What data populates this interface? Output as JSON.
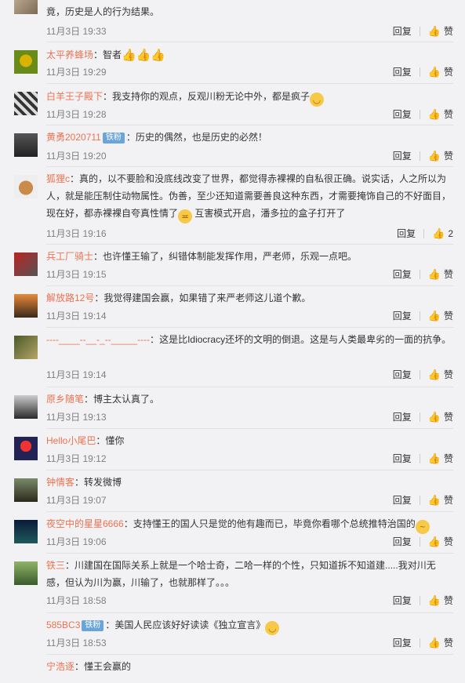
{
  "actions": {
    "reply": "回复",
    "like": "赞"
  },
  "comments": [
    {
      "text": "竟，历史是人的行为结果。",
      "time": "11月3日 19:33",
      "like": "赞"
    },
    {
      "user": "太平养蜂场",
      "text": "智者",
      "time": "11月3日 19:29",
      "like": "赞"
    },
    {
      "user": "白羊王子殿下",
      "text": "我支持你的观点，反观川粉无论中外，都是疯子",
      "time": "11月3日 19:28",
      "like": "赞"
    },
    {
      "user": "黄勇2020711",
      "badge": "铁粉",
      "text": "历史的偶然，也是历史的必然！",
      "time": "11月3日 19:20",
      "like": "赞"
    },
    {
      "user": "狐狸c",
      "text": "真的，以不要脸和没底线改变了世界，都觉得赤裸裸的自私很正确。说实话，人之所以为人，就是能压制住动物属性。伪善，至少还知道需要善良这种东西，才需要掩饰自己的不好面目，现在好，都赤裸裸自夸真性情了",
      "text2": "互害模式开启，潘多拉的盒子打开了",
      "time": "11月3日 19:16",
      "like": "2"
    },
    {
      "user": "兵工厂骑士",
      "text": "也许懂王输了，纠错体制能发挥作用，严老师，乐观一点吧。",
      "time": "11月3日 19:15",
      "like": "赞"
    },
    {
      "user": "解放路12号",
      "text": "我觉得建国会赢，如果错了来严老师这儿道个歉。",
      "time": "11月3日 19:14",
      "like": "赞"
    },
    {
      "user": "----____--__-_--_____----",
      "text": "这是比Idiocracy还坏的文明的倒退。这是与人类最卑劣的一面的抗争。",
      "time": "11月3日 19:14",
      "like": "赞"
    },
    {
      "user": "原乡随笔",
      "text": "博主太认真了。",
      "time": "11月3日 19:13",
      "like": "赞"
    },
    {
      "user": "Hello小尾巴",
      "text": "懂你",
      "time": "11月3日 19:12",
      "like": "赞"
    },
    {
      "user": "钟情客",
      "text": "转发微博",
      "time": "11月3日 19:07",
      "like": "赞"
    },
    {
      "user": "夜空中的星星6666",
      "text": "支持懂王的国人只是觉的他有趣而已，毕竟你看哪个总统推特治国的",
      "time": "11月3日 19:06",
      "like": "赞"
    },
    {
      "user": "铁三",
      "text": "川建国在国际关系上就是一个哈士奇，二哈一样的个性，只知道拆不知道建.....我对川无感，但认为川为赢，川输了，也就那样了。。。",
      "time": "11月3日 18:58",
      "like": "赞"
    },
    {
      "user": "585BC3",
      "badge": "铁粉",
      "text": "美国人民应该好好读读《独立宣言》",
      "time": "11月3日 18:53",
      "like": "赞"
    },
    {
      "user": "宁浩逐",
      "text": "懂王会赢的"
    }
  ],
  "colors": {
    "username": "#eb7350",
    "badge": "#6aa5d9",
    "time": "#808080"
  }
}
